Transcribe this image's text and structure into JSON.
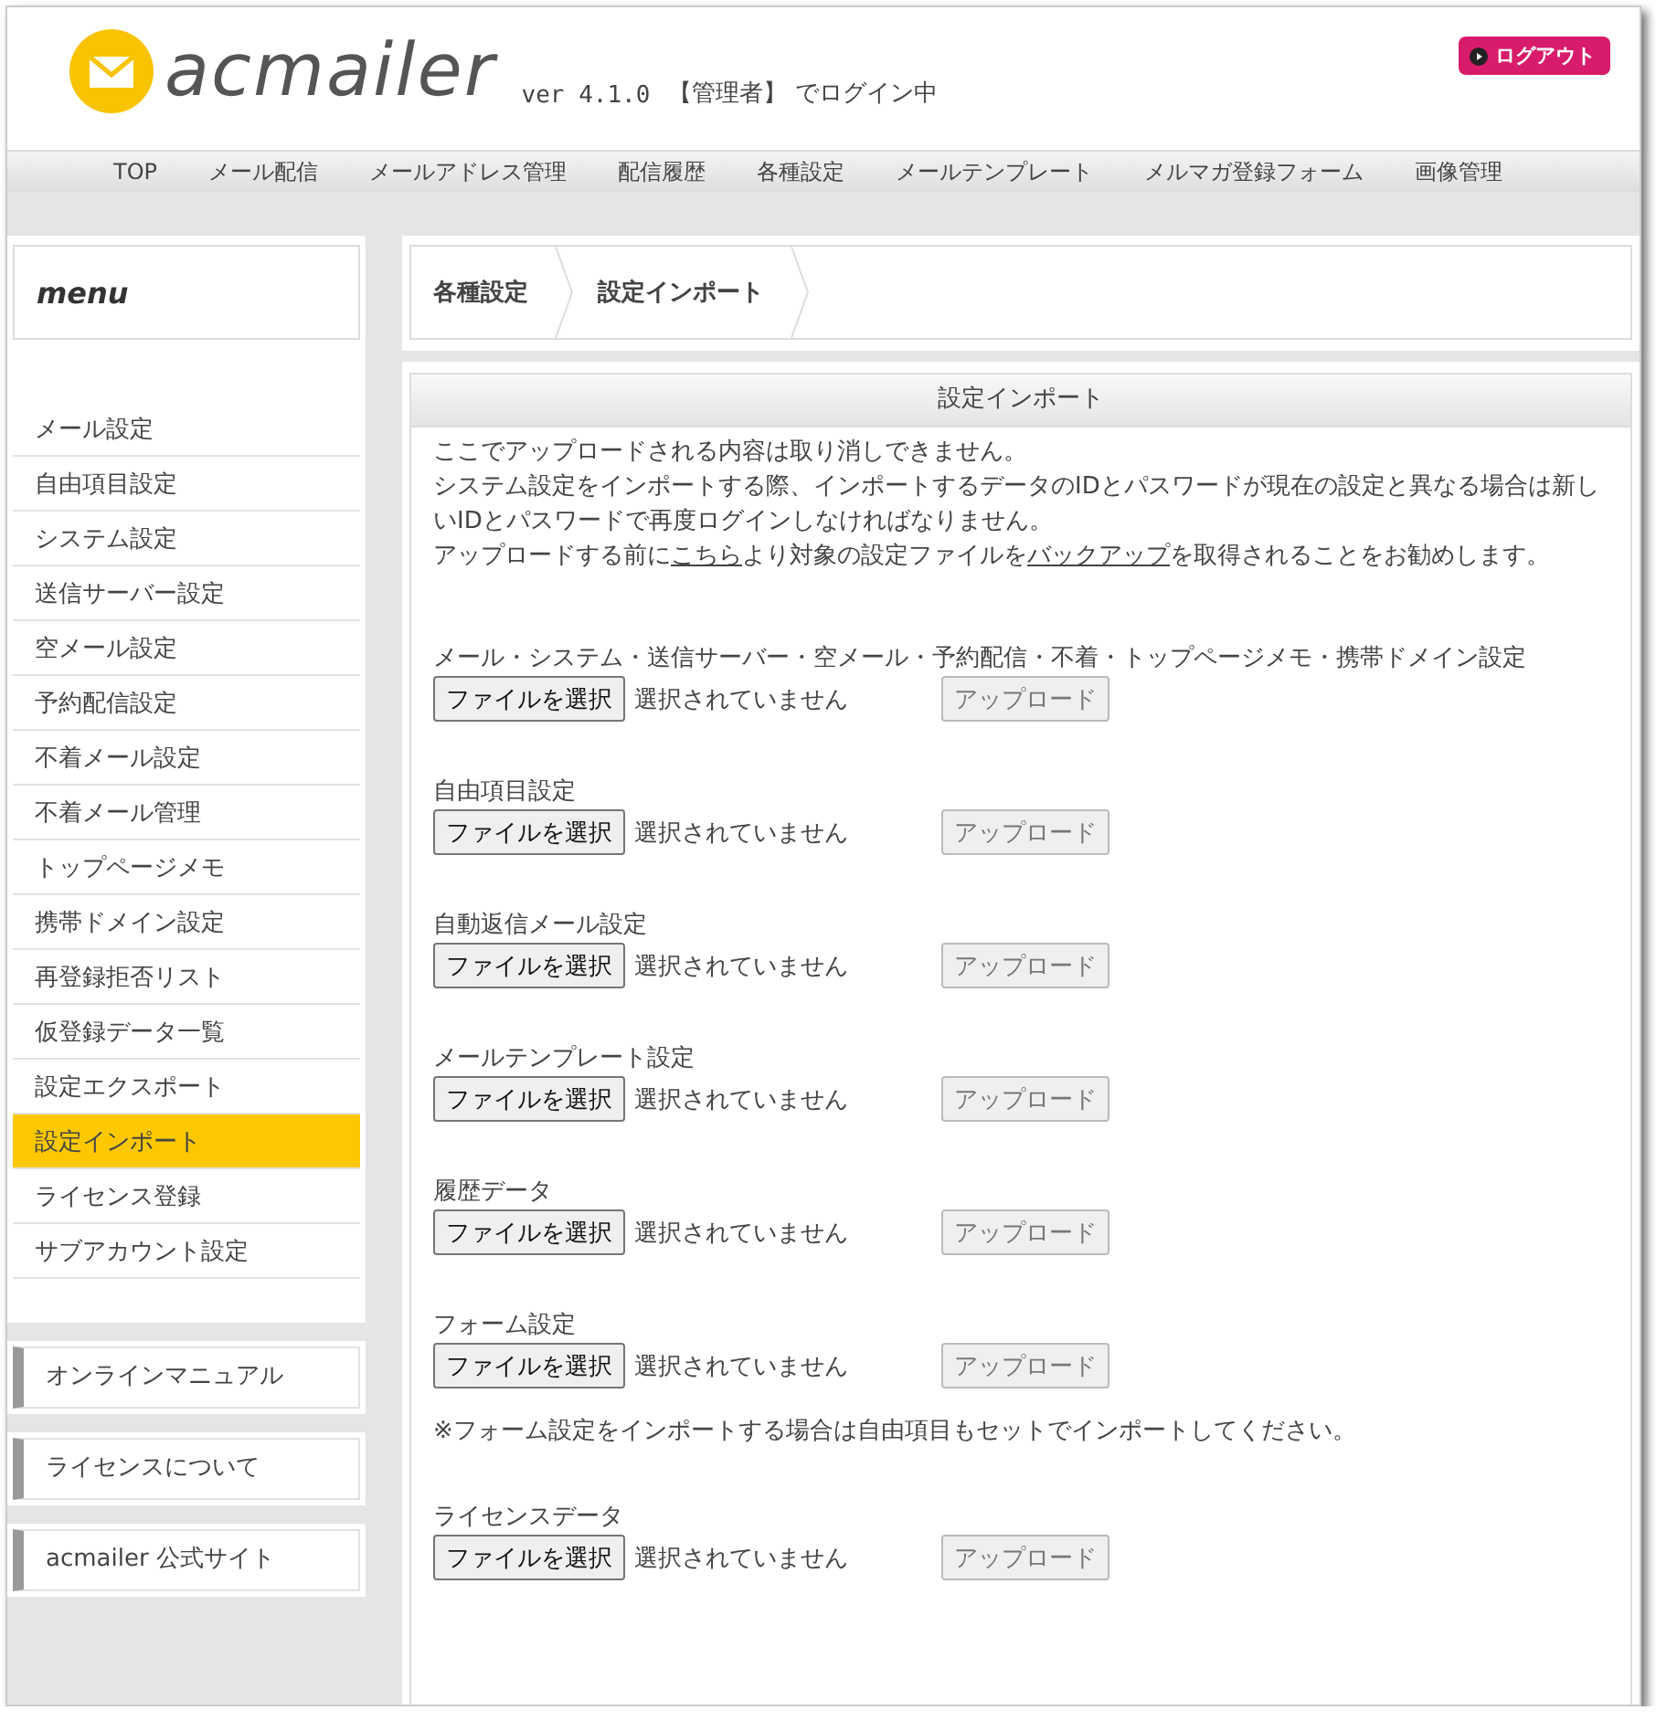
{
  "header": {
    "logo_text": "acmailer",
    "version": "ver 4.1.0",
    "login_status": "【管理者】 でログイン中",
    "logout": "ログアウト"
  },
  "nav": [
    "TOP",
    "メール配信",
    "メールアドレス管理",
    "配信履歴",
    "各種設定",
    "メールテンプレート",
    "メルマガ登録フォーム",
    "画像管理"
  ],
  "sidebar": {
    "title": "menu",
    "items": [
      {
        "label": "メール設定",
        "selected": false
      },
      {
        "label": "自由項目設定",
        "selected": false
      },
      {
        "label": "システム設定",
        "selected": false
      },
      {
        "label": "送信サーバー設定",
        "selected": false
      },
      {
        "label": "空メール設定",
        "selected": false
      },
      {
        "label": "予約配信設定",
        "selected": false
      },
      {
        "label": "不着メール設定",
        "selected": false
      },
      {
        "label": "不着メール管理",
        "selected": false
      },
      {
        "label": "トップページメモ",
        "selected": false
      },
      {
        "label": "携帯ドメイン設定",
        "selected": false
      },
      {
        "label": "再登録拒否リスト",
        "selected": false
      },
      {
        "label": "仮登録データ一覧",
        "selected": false
      },
      {
        "label": "設定エクスポート",
        "selected": false
      },
      {
        "label": "設定インポート",
        "selected": true
      },
      {
        "label": "ライセンス登録",
        "selected": false
      },
      {
        "label": "サブアカウント設定",
        "selected": false
      }
    ],
    "links": [
      "オンラインマニュアル",
      "ライセンスについて",
      "acmailer 公式サイト"
    ]
  },
  "breadcrumb": [
    "各種設定",
    "設定インポート"
  ],
  "panel": {
    "title": "設定インポート",
    "notice": [
      [
        {
          "kind": "text",
          "text": "ここでアップロードされる内容は取り消しできません。"
        }
      ],
      [
        {
          "kind": "text",
          "text": "システム設定をインポートする際、インポートするデータのIDとパスワードが現在の設定と異なる場合は新しいIDとパスワードで再度ログインしなければなりません。"
        }
      ],
      [
        {
          "kind": "text",
          "text": "アップロードする前に"
        },
        {
          "kind": "link",
          "text": "こちら"
        },
        {
          "kind": "text",
          "text": "より対象の設定ファイルを"
        },
        {
          "kind": "link",
          "text": "バックアップ"
        },
        {
          "kind": "text",
          "text": "を取得されることをお勧めします。"
        }
      ]
    ],
    "sections": [
      {
        "label": "メール・システム・送信サーバー・空メール・予約配信・不着・トップページメモ・携帯ドメイン設定",
        "file_button": "ファイルを選択",
        "file_status": "選択されていません",
        "upload": {
          "label": "アップロード",
          "disabled": true
        }
      },
      {
        "label": "自由項目設定",
        "file_button": "ファイルを選択",
        "file_status": "選択されていません",
        "upload": {
          "label": "アップロード",
          "disabled": true
        }
      },
      {
        "label": "自動返信メール設定",
        "file_button": "ファイルを選択",
        "file_status": "選択されていません",
        "upload": {
          "label": "アップロード",
          "disabled": true
        }
      },
      {
        "label": "メールテンプレート設定",
        "file_button": "ファイルを選択",
        "file_status": "選択されていません",
        "upload": {
          "label": "アップロード",
          "disabled": true
        }
      },
      {
        "label": "履歴データ",
        "file_button": "ファイルを選択",
        "file_status": "選択されていません",
        "upload": {
          "label": "アップロード",
          "disabled": true
        }
      },
      {
        "label": "フォーム設定",
        "file_button": "ファイルを選択",
        "file_status": "選択されていません",
        "upload": {
          "label": "アップロード",
          "disabled": true
        },
        "note": "※フォーム設定をインポートする場合は自由項目もセットでインポートしてください。"
      },
      {
        "label": "ライセンスデータ",
        "file_button": "ファイルを選択",
        "file_status": "選択されていません",
        "upload": {
          "label": "アップロード",
          "disabled": true
        }
      }
    ]
  }
}
